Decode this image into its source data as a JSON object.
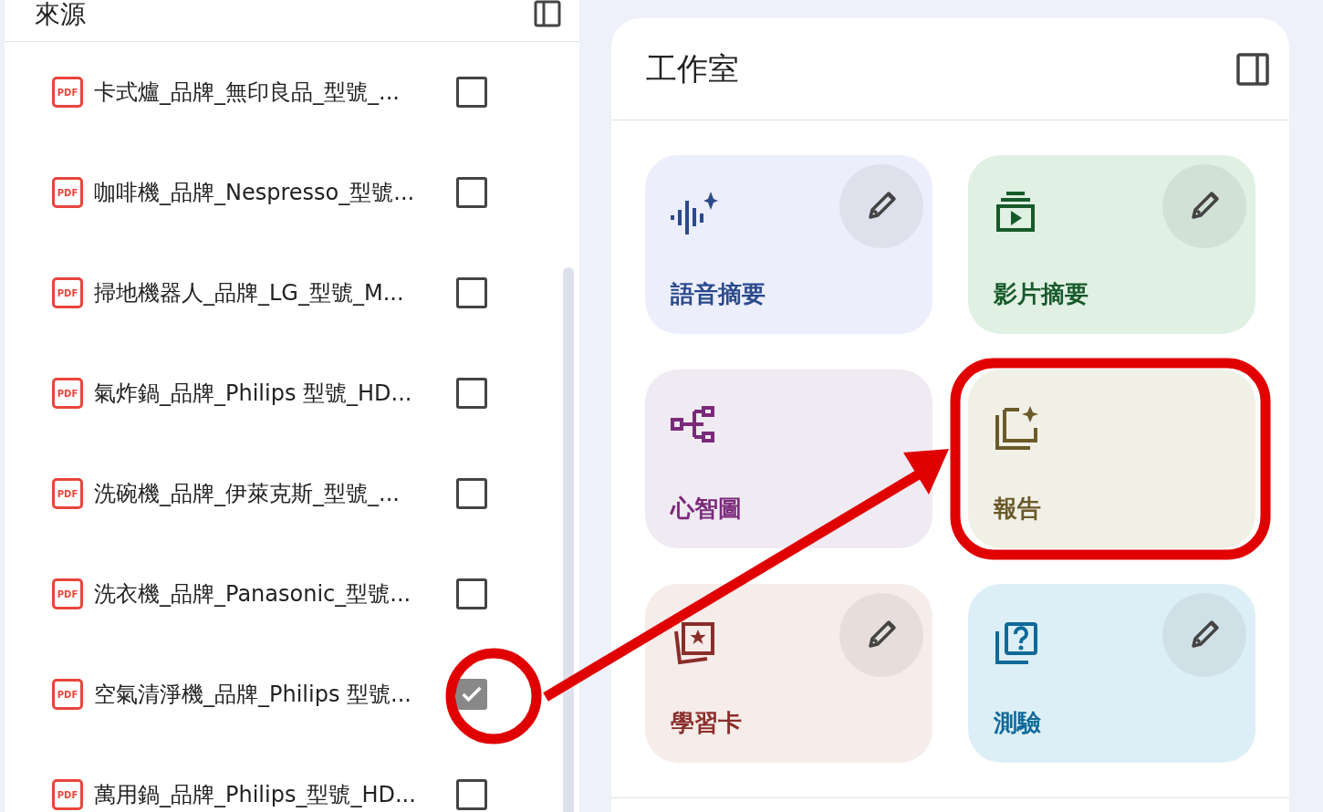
{
  "sources": {
    "title": "來源",
    "items": [
      {
        "badge": "PDF",
        "name": "卡式爐_品牌_無印良品_型號_...",
        "checked": false
      },
      {
        "badge": "PDF",
        "name": "咖啡機_品牌_Nespresso_型號...",
        "checked": false
      },
      {
        "badge": "PDF",
        "name": "掃地機器人_品牌_LG_型號_M...",
        "checked": false
      },
      {
        "badge": "PDF",
        "name": "氣炸鍋_品牌_Philips 型號_HD...",
        "checked": false
      },
      {
        "badge": "PDF",
        "name": "洗碗機_品牌_伊萊克斯_型號_...",
        "checked": false
      },
      {
        "badge": "PDF",
        "name": "洗衣機_品牌_Panasonic_型號...",
        "checked": false
      },
      {
        "badge": "PDF",
        "name": "空氣清淨機_品牌_Philips 型號...",
        "checked": true
      },
      {
        "badge": "PDF",
        "name": "萬用鍋_品牌_Philips_型號_HD...",
        "checked": false
      }
    ]
  },
  "studio": {
    "title": "工作室",
    "cards": [
      {
        "kind": "audio",
        "label": "語音摘要",
        "color": "#eceefb",
        "editable": true
      },
      {
        "kind": "video",
        "label": "影片摘要",
        "color": "#e0f0e3",
        "editable": true
      },
      {
        "kind": "mindmap",
        "label": "心智圖",
        "color": "#f0eaf2",
        "editable": false
      },
      {
        "kind": "report",
        "label": "報告",
        "color": "#f1f0e6",
        "editable": false
      },
      {
        "kind": "flashcard",
        "label": "學習卡",
        "color": "#f6ecea",
        "editable": true
      },
      {
        "kind": "quiz",
        "label": "測驗",
        "color": "#ddeff6",
        "editable": true
      }
    ]
  }
}
